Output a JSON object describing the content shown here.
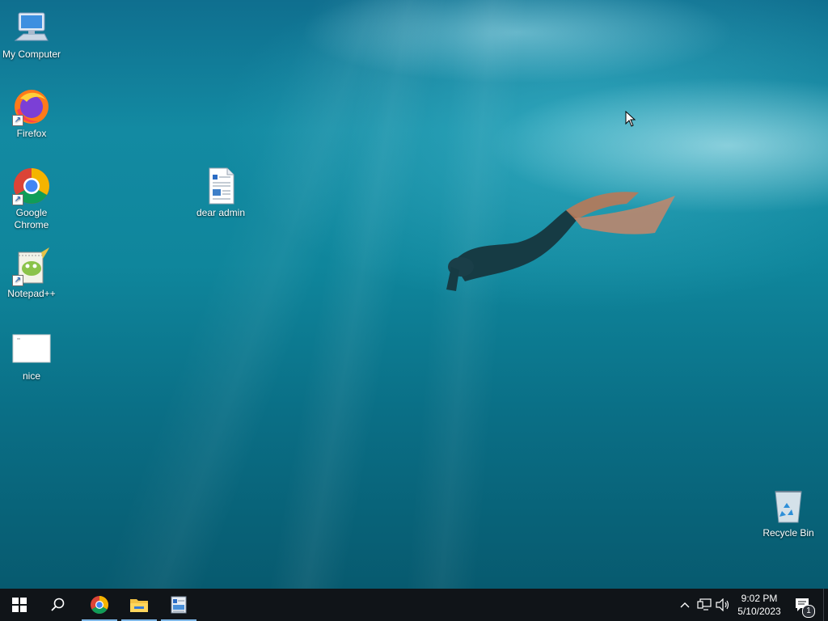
{
  "desktop": {
    "icons": [
      {
        "label": "My Computer",
        "icon": "my-computer-icon"
      },
      {
        "label": "Firefox",
        "icon": "firefox-icon"
      },
      {
        "label": "Google Chrome",
        "icon": "chrome-icon"
      },
      {
        "label": "Notepad++",
        "icon": "notepad-plus-plus-icon"
      },
      {
        "label": "nice",
        "icon": "blank-file-icon"
      },
      {
        "label": "dear admin",
        "icon": "document-icon"
      },
      {
        "label": "Recycle Bin",
        "icon": "recycle-bin-icon"
      }
    ]
  },
  "taskbar": {
    "pinned": [
      {
        "name": "start",
        "icon": "windows-logo-icon"
      },
      {
        "name": "search",
        "icon": "search-icon"
      },
      {
        "name": "chrome",
        "icon": "chrome-icon"
      },
      {
        "name": "file-explorer",
        "icon": "folder-icon"
      },
      {
        "name": "document-viewer",
        "icon": "document-app-icon"
      }
    ],
    "tray": {
      "icons": [
        "chevron-up-icon",
        "network-icon",
        "volume-icon"
      ],
      "time": "9:02 PM",
      "date": "5/10/2023",
      "notification_count": "1"
    }
  }
}
